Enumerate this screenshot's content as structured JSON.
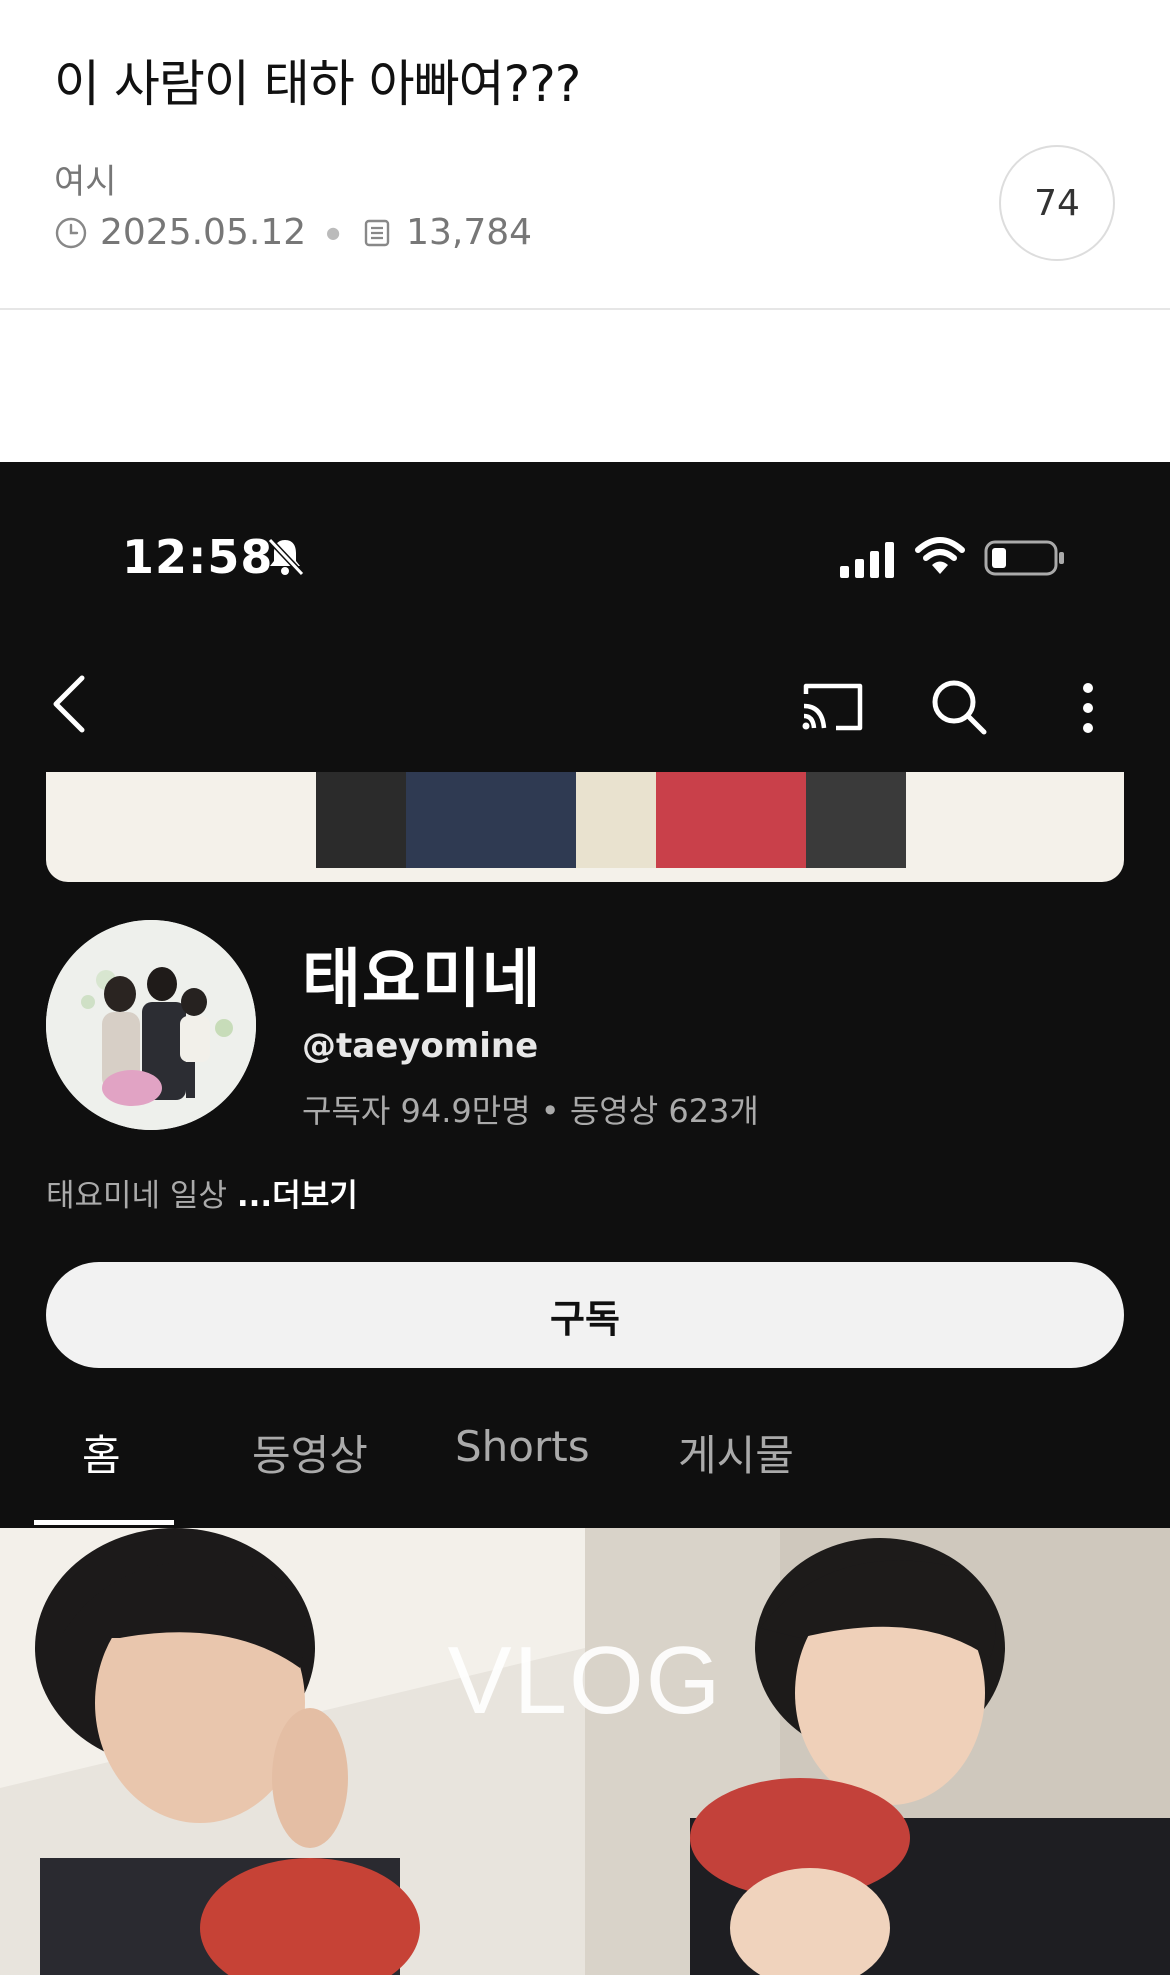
{
  "post": {
    "title": "이 사람이 태하 아빠여???",
    "author": "여시",
    "date": "2025.05.12",
    "views": "13,784",
    "comment_count": "74"
  },
  "phone": {
    "status_time": "12:58"
  },
  "channel": {
    "name": "태요미네",
    "handle": "@taeyomine",
    "stats": "구독자 94.9만명 • 동영상 623개",
    "description": "태요미네 일상",
    "more_label": "...더보기",
    "subscribe_label": "구독",
    "tabs": [
      {
        "label": "홈",
        "active": true
      },
      {
        "label": "동영상",
        "active": false
      },
      {
        "label": "Shorts",
        "active": false
      },
      {
        "label": "게시물",
        "active": false
      }
    ],
    "thumbnail_text": "VLOG"
  },
  "colors": {
    "background_dark": "#0f0f0f",
    "text_muted": "#aaaaaa",
    "subscribe_bg": "#f2f2f2"
  }
}
